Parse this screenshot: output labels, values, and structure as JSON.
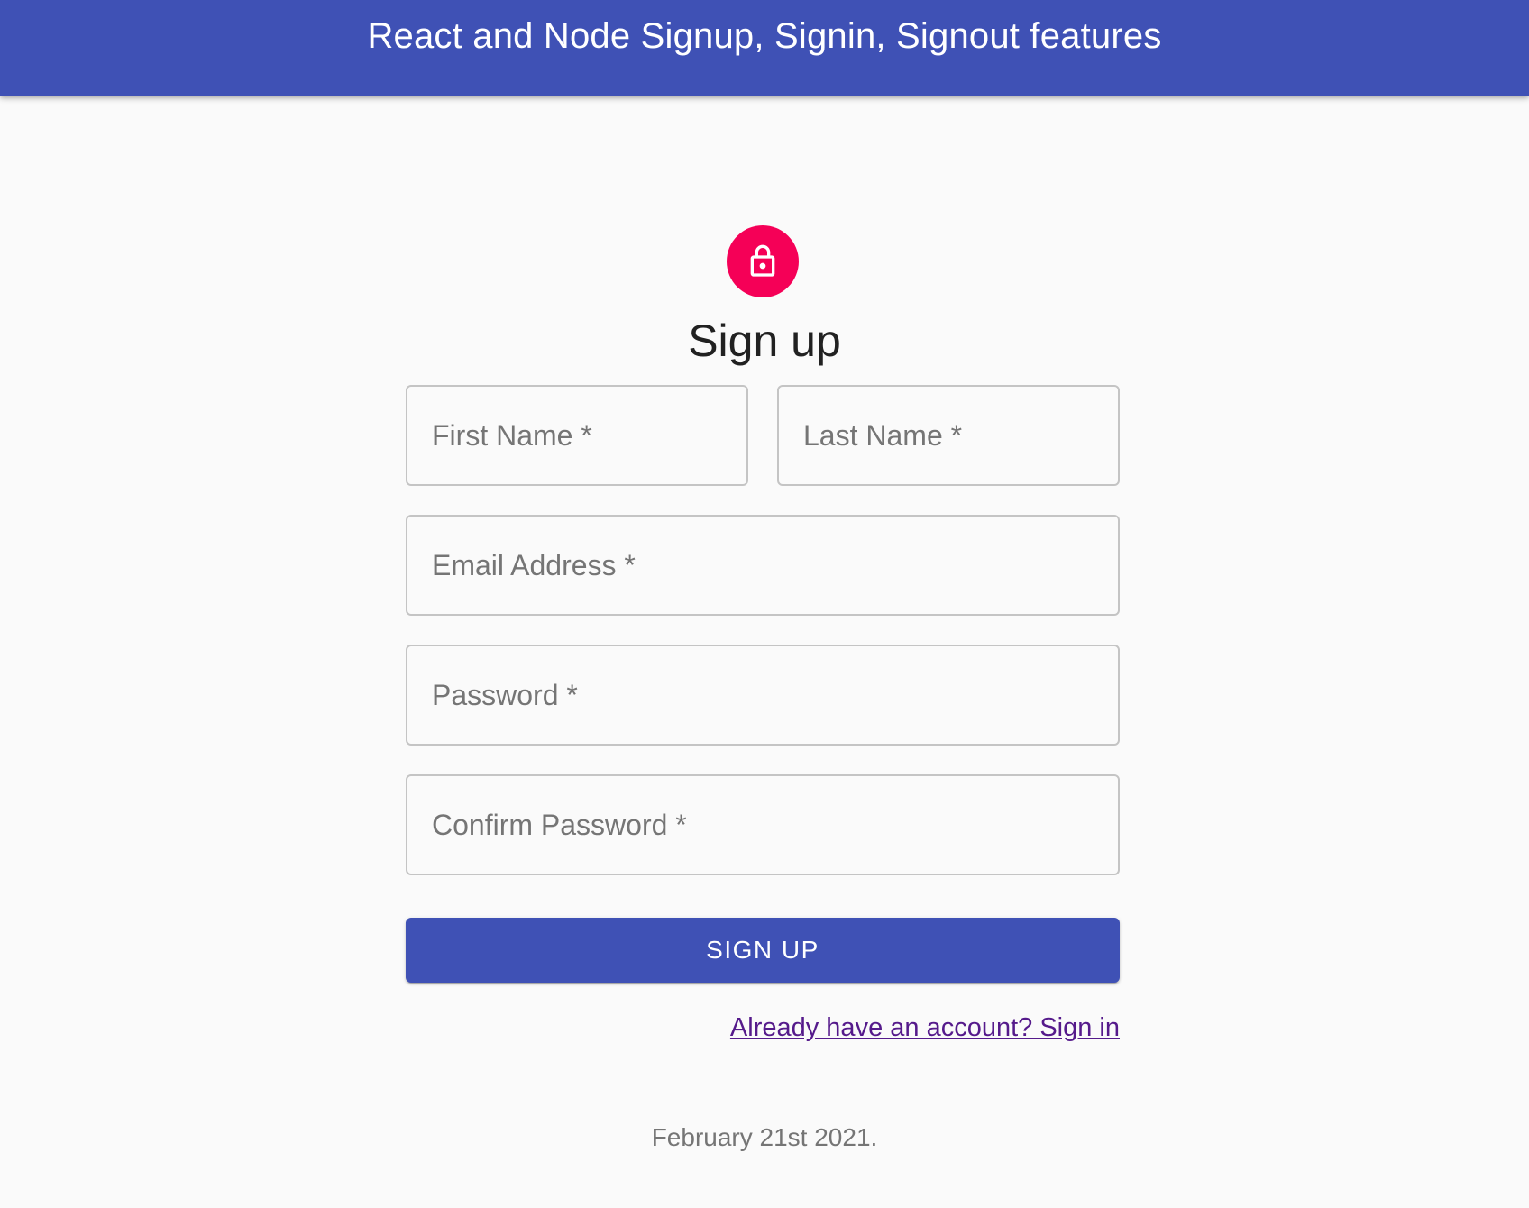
{
  "app_bar": {
    "title": "React and Node Signup, Signin, Signout features"
  },
  "avatar": {
    "icon": "lock-outline-icon"
  },
  "form": {
    "title": "Sign up",
    "fields": {
      "first_name": {
        "label": "First Name *",
        "value": ""
      },
      "last_name": {
        "label": "Last Name *",
        "value": ""
      },
      "email": {
        "label": "Email Address *",
        "value": ""
      },
      "password": {
        "label": "Password *",
        "value": ""
      },
      "confirm_password": {
        "label": "Confirm Password *",
        "value": ""
      }
    },
    "submit_label": "SIGN UP",
    "signin_link": "Already have an account? Sign in"
  },
  "footer": {
    "date": "February 21st 2021."
  },
  "colors": {
    "primary": "#3f51b5",
    "secondary": "#f50057",
    "link": "#551a8b"
  }
}
